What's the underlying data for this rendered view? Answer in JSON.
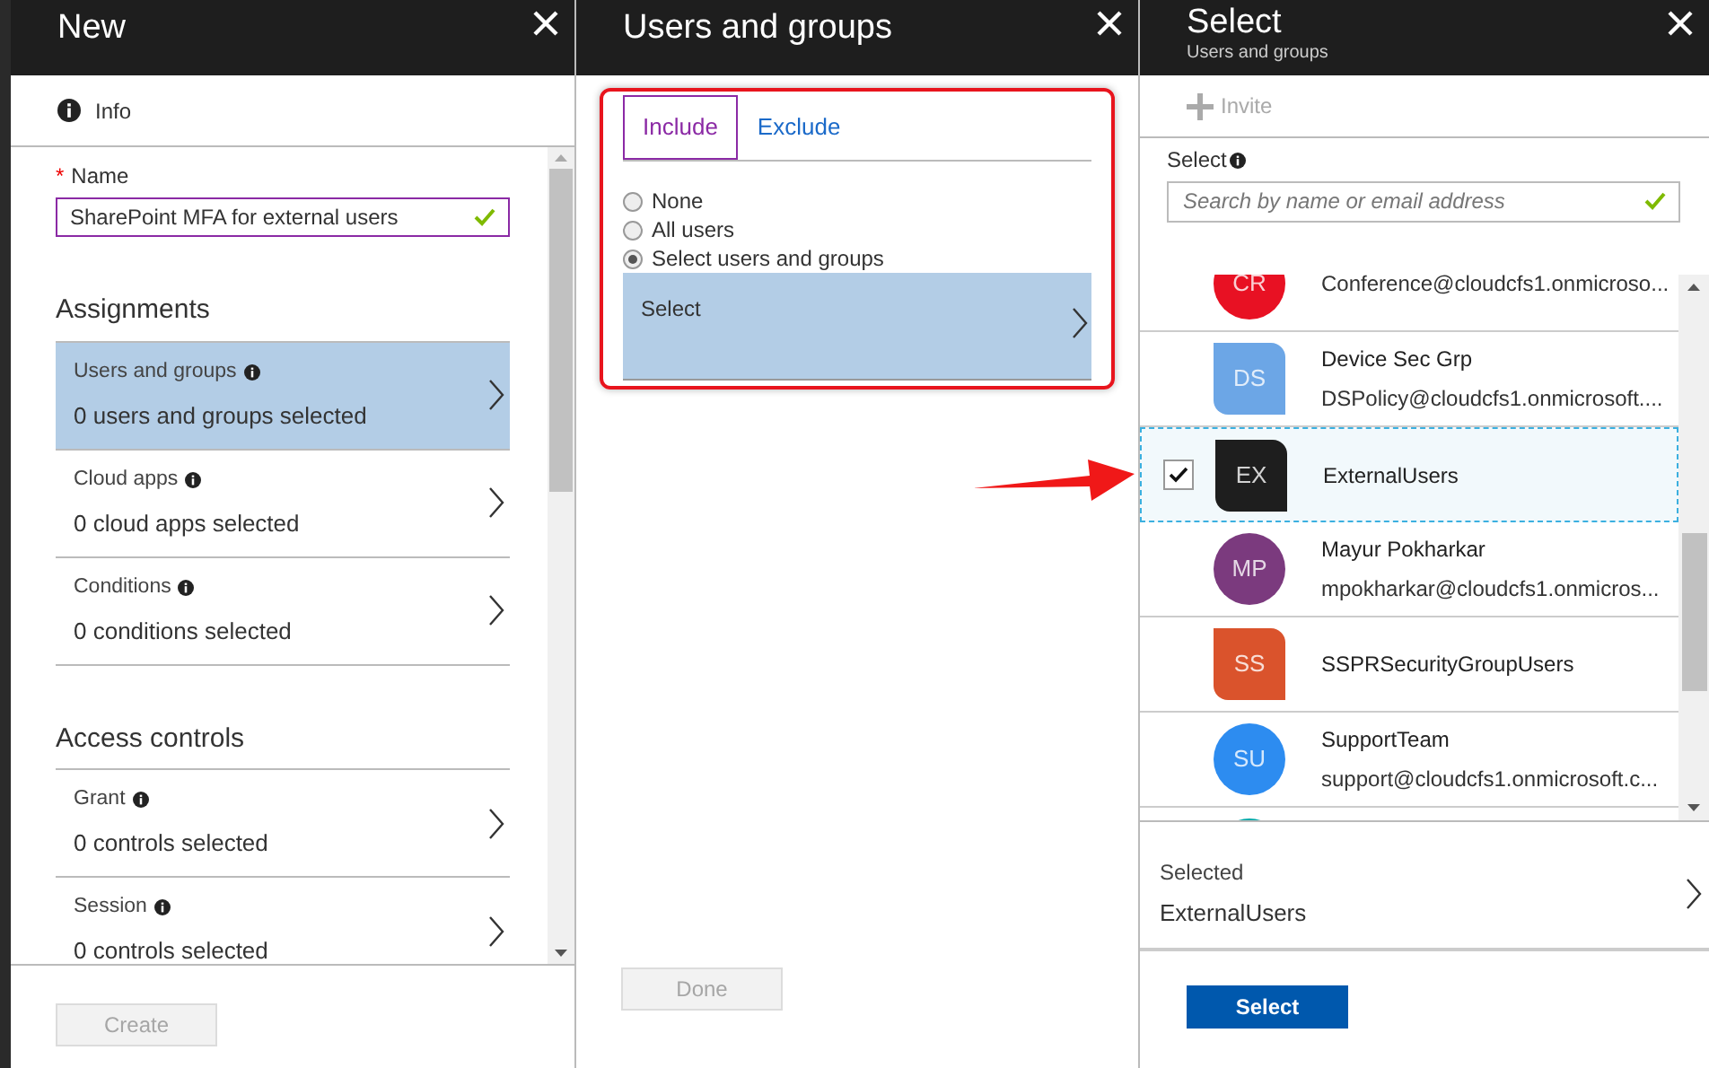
{
  "new_panel": {
    "title": "New",
    "info_label": "Info",
    "name_field": {
      "required_mark": "*",
      "label": "Name",
      "value": "SharePoint MFA for external users",
      "valid": true
    },
    "sections": [
      {
        "heading": "Assignments",
        "items": [
          {
            "label": "Users and groups",
            "value": "0 users and groups selected",
            "selected": true
          },
          {
            "label": "Cloud apps",
            "value": "0 cloud apps selected",
            "selected": false
          },
          {
            "label": "Conditions",
            "value": "0 conditions selected",
            "selected": false
          }
        ]
      },
      {
        "heading": "Access controls",
        "items": [
          {
            "label": "Grant",
            "value": "0 controls selected",
            "selected": false
          },
          {
            "label": "Session",
            "value": "0 controls selected",
            "selected": false
          }
        ]
      }
    ],
    "button": {
      "label": "Create",
      "disabled": true
    }
  },
  "users_groups_panel": {
    "title": "Users and groups",
    "tabs": [
      {
        "label": "Include",
        "selected": true
      },
      {
        "label": "Exclude",
        "selected": false
      }
    ],
    "options": [
      {
        "label": "None",
        "selected": false
      },
      {
        "label": "All users",
        "selected": false
      },
      {
        "label": "Select users and groups",
        "selected": true
      }
    ],
    "select_row": {
      "label": "Select"
    },
    "button": {
      "label": "Done",
      "disabled": true
    }
  },
  "select_panel": {
    "title": "Select",
    "subtitle": "Users and groups",
    "invite": {
      "label": "Invite",
      "disabled": true
    },
    "search": {
      "label": "Select",
      "placeholder": "Search by name or email address",
      "valid": true
    },
    "items": [
      {
        "initials": "CR",
        "email": "Conference@cloudcfs1.onmicroso...",
        "color": "#e81123",
        "kind": "user",
        "checked": false
      },
      {
        "initials": "DS",
        "name": "Device Sec Grp",
        "email": "DSPolicy@cloudcfs1.onmicrosoft....",
        "color": "#6ca6e6",
        "kind": "group",
        "checked": false
      },
      {
        "initials": "EX",
        "name": "ExternalUsers",
        "color": "#1e1e1e",
        "kind": "group",
        "checked": true
      },
      {
        "initials": "MP",
        "name": "Mayur Pokharkar",
        "email": "mpokharkar@cloudcfs1.onmicros...",
        "color": "#7b3a7e",
        "kind": "user",
        "checked": false
      },
      {
        "initials": "SS",
        "name": "SSPRSecurityGroupUsers",
        "color": "#da532c",
        "kind": "group",
        "checked": false
      },
      {
        "initials": "SU",
        "name": "SupportTeam",
        "email": "support@cloudcfs1.onmicrosoft.c...",
        "color": "#2d8cf0",
        "kind": "user",
        "checked": false
      },
      {
        "color": "#00a8a8",
        "kind": "user",
        "checked": false
      }
    ],
    "selected": {
      "label": "Selected",
      "value": "ExternalUsers"
    },
    "button": {
      "label": "Select",
      "disabled": false
    }
  }
}
